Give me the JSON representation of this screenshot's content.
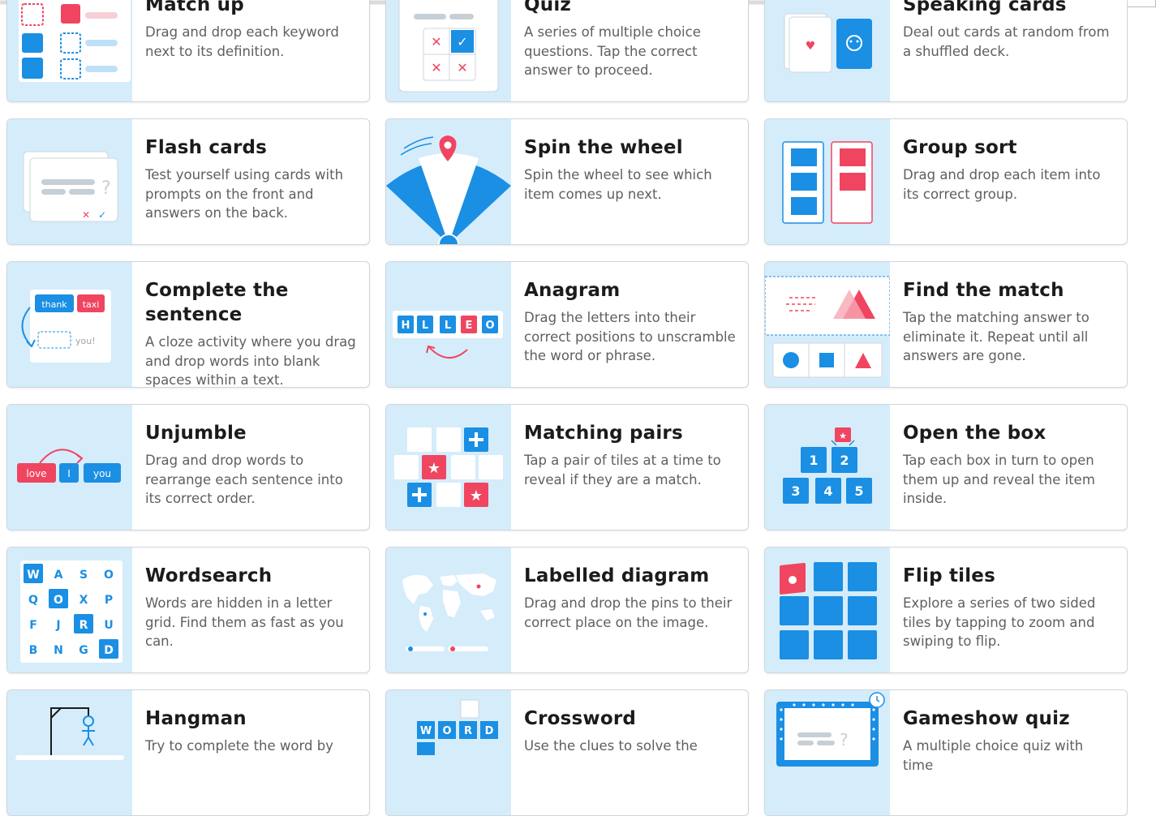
{
  "templates": [
    {
      "id": "match-up",
      "title": "Match up",
      "desc": "Drag and drop each keyword next to its definition.",
      "icon": "match-up-icon"
    },
    {
      "id": "quiz",
      "title": "Quiz",
      "desc": "A series of multiple choice questions. Tap the correct answer to proceed.",
      "icon": "quiz-icon"
    },
    {
      "id": "speaking-cards",
      "title": "Speaking cards",
      "desc": "Deal out cards at random from a shuffled deck.",
      "icon": "cards-icon"
    },
    {
      "id": "flash-cards",
      "title": "Flash cards",
      "desc": "Test yourself using cards with prompts on the front and answers on the back.",
      "icon": "flash-cards-icon"
    },
    {
      "id": "spin-the-wheel",
      "title": "Spin the wheel",
      "desc": "Spin the wheel to see which item comes up next.",
      "icon": "wheel-icon"
    },
    {
      "id": "group-sort",
      "title": "Group sort",
      "desc": "Drag and drop each item into its correct group.",
      "icon": "group-sort-icon"
    },
    {
      "id": "complete-the-sentence",
      "title": "Complete the sentence",
      "desc": "A cloze activity where you drag and drop words into blank spaces within a text.",
      "icon": "cloze-icon",
      "thumb_words": [
        "thank",
        "taxi",
        "you!"
      ]
    },
    {
      "id": "anagram",
      "title": "Anagram",
      "desc": "Drag the letters into their correct positions to unscramble the word or phrase.",
      "icon": "anagram-icon",
      "thumb_letters": [
        "H",
        "L",
        "L",
        "E",
        "O"
      ]
    },
    {
      "id": "find-the-match",
      "title": "Find the match",
      "desc": "Tap the matching answer to eliminate it. Repeat until all answers are gone.",
      "icon": "find-match-icon"
    },
    {
      "id": "unjumble",
      "title": "Unjumble",
      "desc": "Drag and drop words to rearrange each sentence into its correct order.",
      "icon": "unjumble-icon",
      "thumb_words": [
        "love",
        "I",
        "you"
      ]
    },
    {
      "id": "matching-pairs",
      "title": "Matching pairs",
      "desc": "Tap a pair of tiles at a time to reveal if they are a match.",
      "icon": "tiles-icon"
    },
    {
      "id": "open-the-box",
      "title": "Open the box",
      "desc": "Tap each box in turn to open them up and reveal the item inside.",
      "icon": "boxes-icon",
      "thumb_numbers": [
        "1",
        "2",
        "3",
        "4",
        "5"
      ]
    },
    {
      "id": "wordsearch",
      "title": "Wordsearch",
      "desc": "Words are hidden in a letter grid. Find them as fast as you can.",
      "icon": "wordsearch-icon",
      "thumb_grid": [
        "W",
        "A",
        "S",
        "O",
        "Q",
        "O",
        "X",
        "P",
        "F",
        "J",
        "R",
        "U",
        "B",
        "N",
        "G",
        "D"
      ]
    },
    {
      "id": "labelled-diagram",
      "title": "Labelled diagram",
      "desc": "Drag and drop the pins to their correct place on the image.",
      "icon": "map-icon"
    },
    {
      "id": "flip-tiles",
      "title": "Flip tiles",
      "desc": "Explore a series of two sided tiles by tapping to zoom and swiping to flip.",
      "icon": "flip-tiles-icon"
    },
    {
      "id": "hangman",
      "title": "Hangman",
      "desc": "Try to complete the word by",
      "icon": "hangman-icon"
    },
    {
      "id": "crossword",
      "title": "Crossword",
      "desc": "Use the clues to solve the",
      "icon": "crossword-icon",
      "thumb_letters": [
        "W",
        "O",
        "R",
        "D"
      ]
    },
    {
      "id": "gameshow-quiz",
      "title": "Gameshow quiz",
      "desc": "A multiple choice quiz with time",
      "icon": "gameshow-icon"
    }
  ],
  "colors": {
    "accent": "#1a8fe3",
    "red": "#f04560",
    "thumb_bg": "#d5ecfb",
    "text": "#1b1b1b",
    "muted": "#5f5f5f"
  }
}
